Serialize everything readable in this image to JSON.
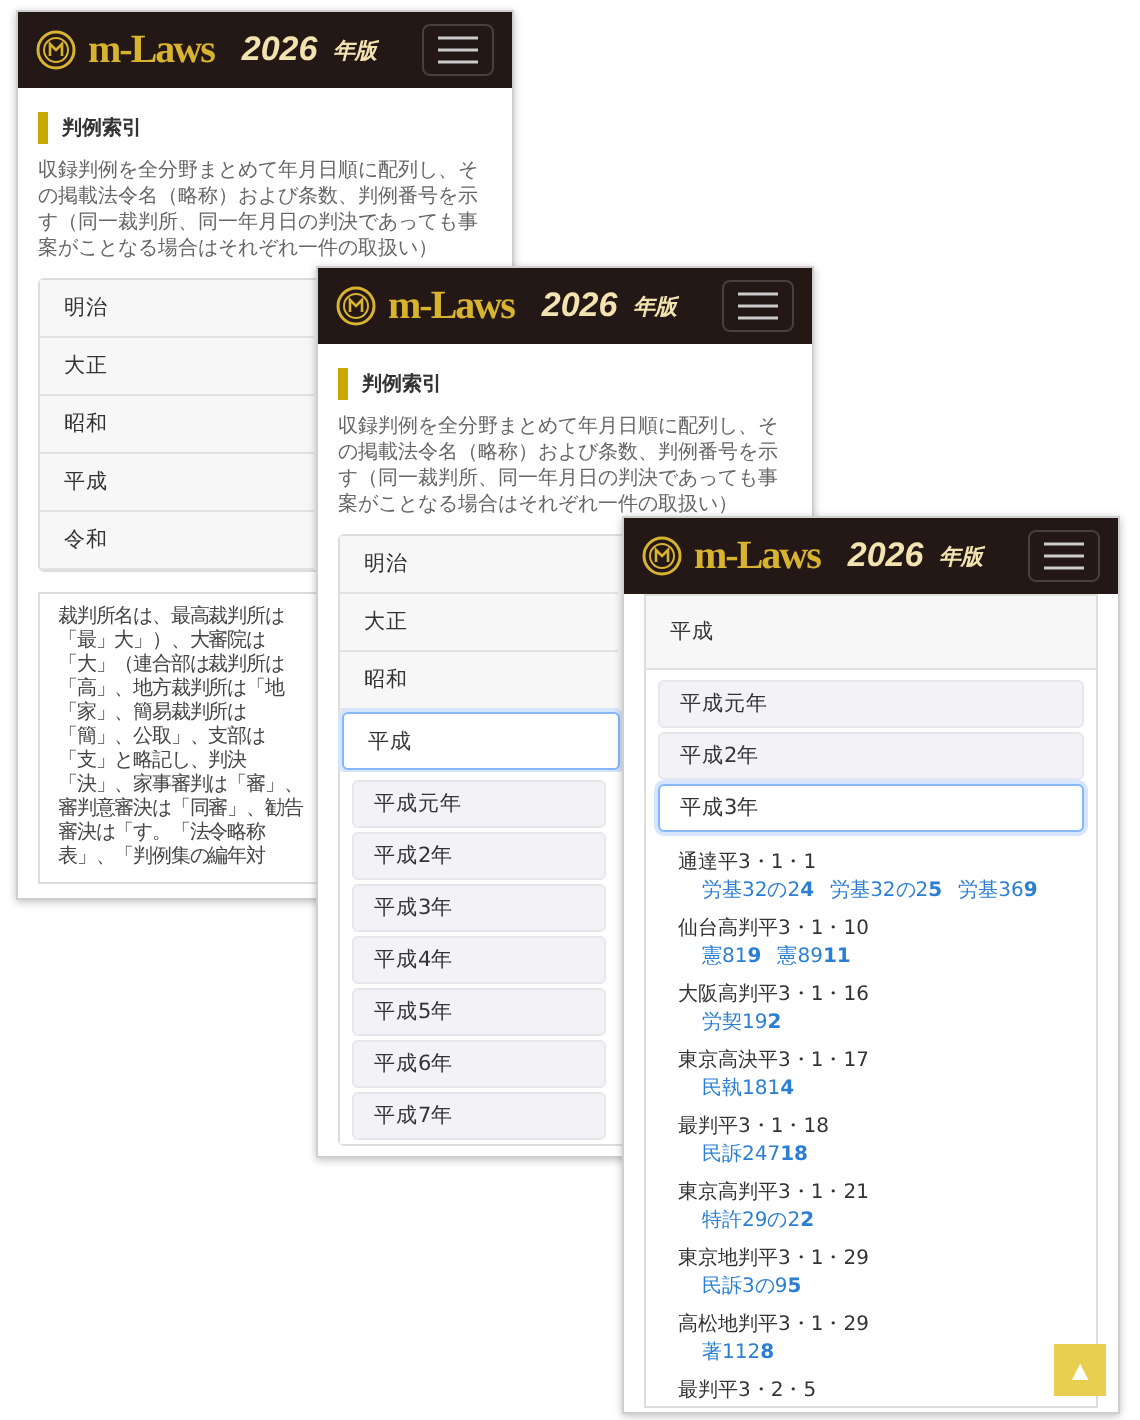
{
  "screens": [
    {
      "kind": "index",
      "header": {
        "logo": "m-Laws",
        "edition": "2026",
        "edition_unit": "年版"
      },
      "section_title": "判例索引",
      "description": "収録判例を全分野まとめて年月日順に配列し、その掲載法令名（略称）および条数、判例番号を示す（同一裁判所、同一年月日の判決であっても事案がことなる場合はそれぞれ一件の取扱い）",
      "eras": [
        {
          "label": "明治",
          "selected": false
        },
        {
          "label": "大正",
          "selected": false
        },
        {
          "label": "昭和",
          "selected": false
        },
        {
          "label": "平成",
          "selected": false
        },
        {
          "label": "令和",
          "selected": false
        }
      ],
      "note": "裁判所名は、最高裁判所は「最」大」）、大審院は「大」（連合部は裁判所は「高」、地方裁判所は「地「家」、簡易裁判所は「簡」、公取」、支部は「支」と略記し、判決「決」、家事審判は「審」、審判意審決は「同審」、勧告審決は「す。「法令略称表」、「判例集の編年対"
    },
    {
      "kind": "index",
      "header": {
        "logo": "m-Laws",
        "edition": "2026",
        "edition_unit": "年版"
      },
      "section_title": "判例索引",
      "description": "収録判例を全分野まとめて年月日順に配列し、その掲載法令名（略称）および条数、判例番号を示す（同一裁判所、同一年月日の判決であっても事案がことなる場合はそれぞれ一件の取扱い）",
      "eras": [
        {
          "label": "明治",
          "selected": false
        },
        {
          "label": "大正",
          "selected": false
        },
        {
          "label": "昭和",
          "selected": false
        },
        {
          "label": "平成",
          "selected": true,
          "years": [
            {
              "label": "平成元年"
            },
            {
              "label": "平成2年"
            },
            {
              "label": "平成3年"
            },
            {
              "label": "平成4年"
            },
            {
              "label": "平成5年"
            },
            {
              "label": "平成6年"
            },
            {
              "label": "平成7年"
            }
          ]
        }
      ]
    },
    {
      "kind": "era",
      "header": {
        "logo": "m-Laws",
        "edition": "2026",
        "edition_unit": "年版"
      },
      "era_title": "平成",
      "years": [
        {
          "label": "平成元年",
          "selected": false
        },
        {
          "label": "平成2年",
          "selected": false
        },
        {
          "label": "平成3年",
          "selected": true
        }
      ],
      "cases": [
        {
          "court": "通達平3・1・1",
          "refs": [
            "労基32の2**4**",
            "労基32の2**5**",
            "労基36**9**"
          ]
        },
        {
          "court": "仙台高判平3・1・10",
          "refs": [
            "憲81**9**",
            "憲89**11**"
          ]
        },
        {
          "court": "大阪高判平3・1・16",
          "refs": [
            "労契19**2**"
          ]
        },
        {
          "court": "東京高決平3・1・17",
          "refs": [
            "民執181**4**"
          ]
        },
        {
          "court": "最判平3・1・18",
          "refs": [
            "民訴247**18**"
          ]
        },
        {
          "court": "東京高判平3・1・21",
          "refs": [
            "特許29の2**2**"
          ]
        },
        {
          "court": "東京地判平3・1・29",
          "refs": [
            "民訴3の9**5**"
          ]
        },
        {
          "court": "高松地判平3・1・29",
          "refs": [
            "著112**8**"
          ]
        },
        {
          "court": "最判平3・2・5"
        }
      ],
      "scroll_top": "▲"
    }
  ]
}
